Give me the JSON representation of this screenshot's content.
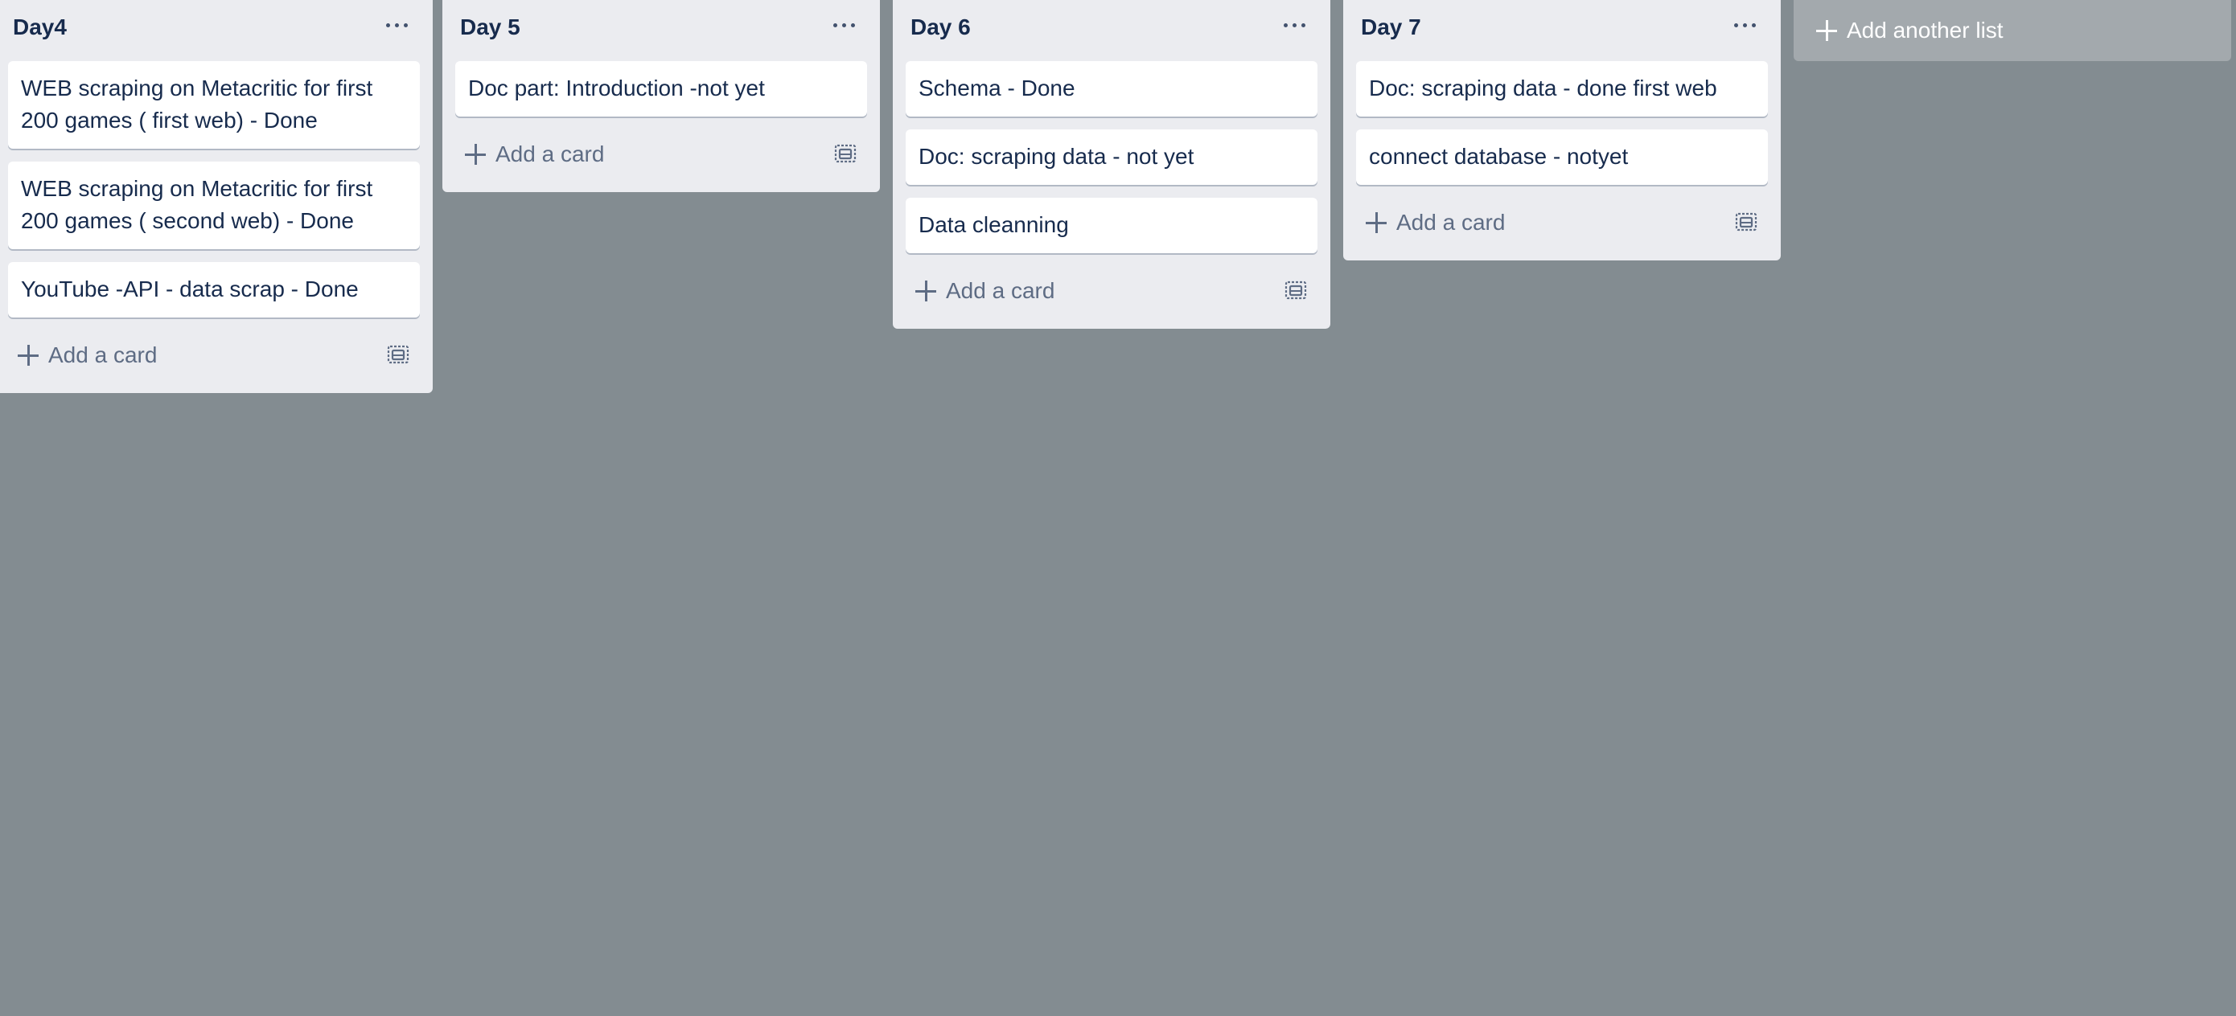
{
  "board": {
    "lists": [
      {
        "title": "Day4",
        "cards": [
          "WEB scraping on Metacritic for first 200 games ( first web) - Done",
          "WEB scraping on Metacritic for first 200 games ( second web) - Done",
          "YouTube -API - data scrap - Done"
        ],
        "add_card_label": "Add a card"
      },
      {
        "title": "Day 5",
        "cards": [
          "Doc part: Introduction -not yet"
        ],
        "add_card_label": "Add a card"
      },
      {
        "title": "Day 6",
        "cards": [
          "Schema - Done",
          "Doc: scraping data - not yet",
          "Data cleanning"
        ],
        "add_card_label": "Add a card"
      },
      {
        "title": "Day 7",
        "cards": [
          "Doc: scraping data - done first web",
          "connect database - notyet"
        ],
        "add_card_label": "Add a card"
      }
    ],
    "add_list_label": "Add another list"
  },
  "icons": {
    "list_menu": "ellipsis-icon",
    "add": "plus-icon",
    "template": "card-template-icon"
  },
  "colors": {
    "board_background": "#838c91",
    "list_background": "#ebecf0",
    "card_background": "#ffffff",
    "title_text": "#172b4d",
    "secondary_text": "#5e6c84",
    "add_list_background": "#a3a9ad"
  }
}
